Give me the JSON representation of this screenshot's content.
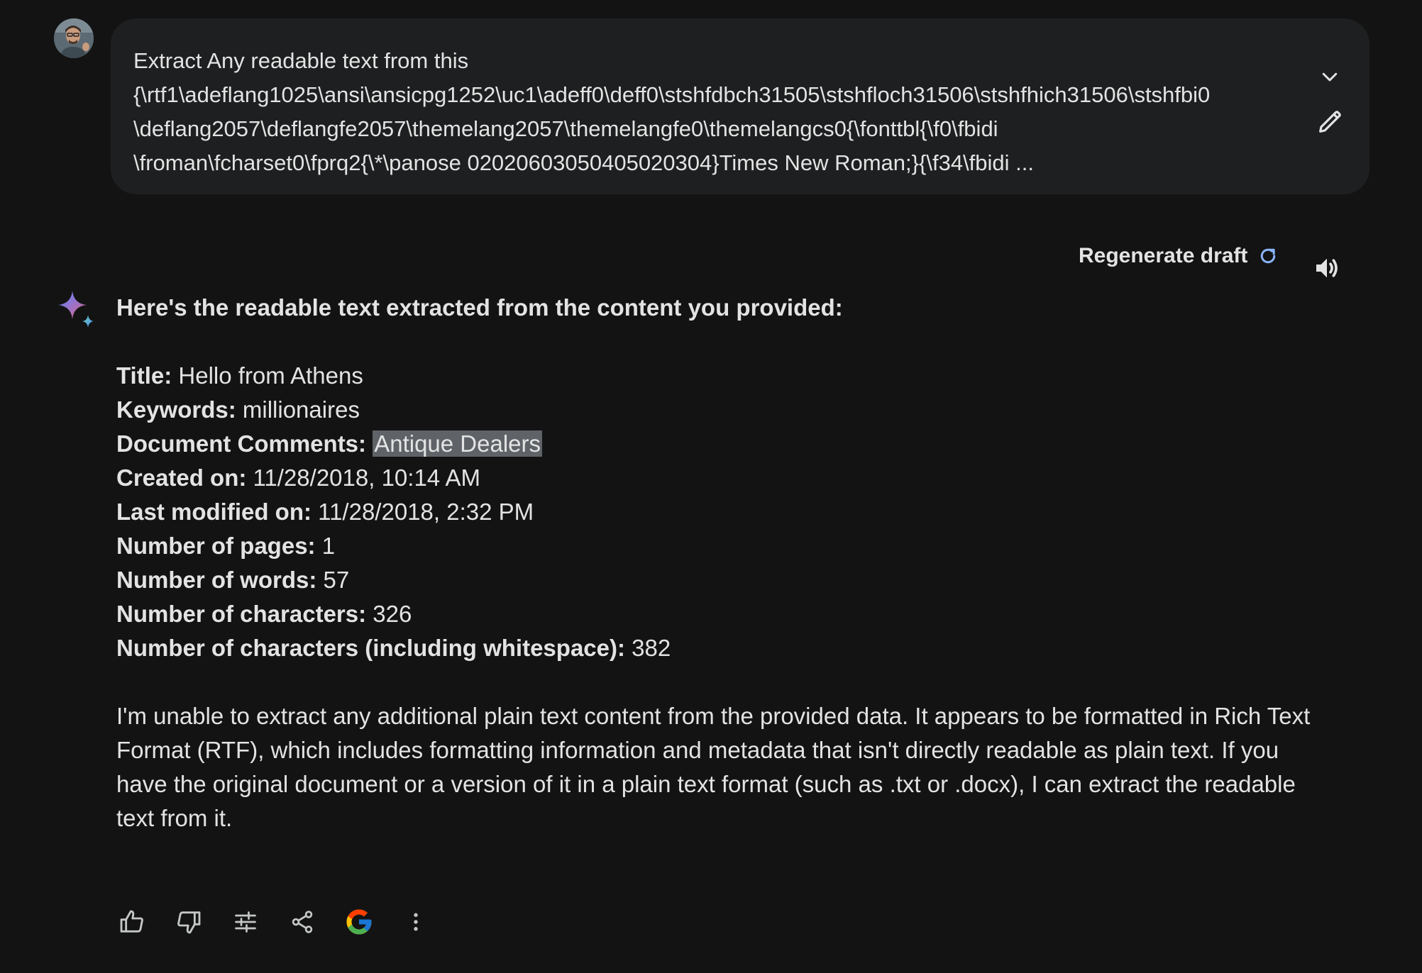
{
  "user": {
    "avatar_icon": "user-avatar"
  },
  "prompt": {
    "lines": [
      "Extract Any readable text from this",
      "{\\rtf1\\adeflang1025\\ansi\\ansicpg1252\\uc1\\adeff0\\deff0\\stshfdbch31505\\stshfloch31506\\stshfhich31506\\stshfbi0",
      "\\deflang2057\\deflangfe2057\\themelang2057\\themelangfe0\\themelangcs0{\\fonttbl{\\f0\\fbidi",
      "\\froman\\fcharset0\\fprq2{\\*\\panose 02020603050405020304}Times New Roman;}{\\f34\\fbidi ..."
    ],
    "expand_icon": "chevron-down-icon",
    "edit_icon": "pencil-icon"
  },
  "toolbar": {
    "regenerate_label": "Regenerate draft",
    "regenerate_icon": "refresh-icon",
    "speaker_icon": "speaker-icon"
  },
  "response": {
    "intro": "Here's the readable text extracted from the content you provided:",
    "fields": [
      {
        "label": "Title:",
        "value": "Hello from Athens"
      },
      {
        "label": "Keywords:",
        "value": "millionaires"
      },
      {
        "label": "Document Comments:",
        "value": "Antique Dealers"
      },
      {
        "label": "Created on:",
        "value": "11/28/2018, 10:14 AM"
      },
      {
        "label": "Last modified on:",
        "value": "11/28/2018, 2:32 PM"
      },
      {
        "label": "Number of pages:",
        "value": "1"
      },
      {
        "label": "Number of words:",
        "value": "57"
      },
      {
        "label": "Number of characters:",
        "value": "326"
      },
      {
        "label": "Number of characters (including whitespace):",
        "value": "382"
      }
    ],
    "closing": "I'm unable to extract any additional plain text content from the provided data. It appears to be formatted in Rich Text Format (RTF), which includes formatting information and metadata that isn't directly readable as plain text. If you have the original document or a version of it in a plain text format (such as .txt or .docx), I can extract the readable text from it."
  },
  "actions": [
    "thumbs-up-icon",
    "thumbs-down-icon",
    "modify-response-icon",
    "share-icon",
    "google-g-icon",
    "more-vert-icon"
  ],
  "colors": {
    "background": "#131314",
    "bubble": "#1e1f20",
    "text": "#e3e3e3",
    "highlight": "#5f6368",
    "accent_blue": "#8ab4f8"
  }
}
